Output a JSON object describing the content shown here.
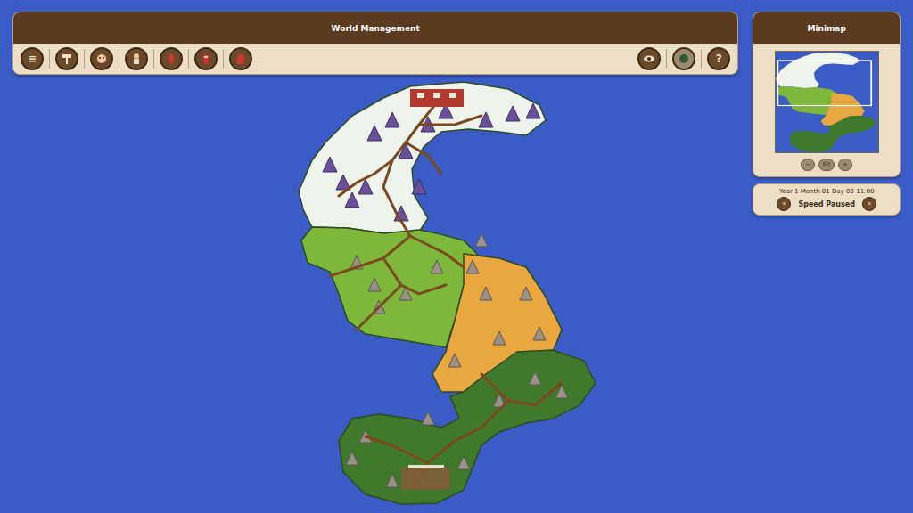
{
  "toolbar": {
    "title": "World Management",
    "menu_glyph": "≡",
    "help_glyph": "?"
  },
  "minimap": {
    "title": "Minimap",
    "zoom_buttons": [
      "−",
      "Fit",
      "+"
    ]
  },
  "time": {
    "date": "Year 1 Month 01 Day 03 11:00",
    "speed": "Speed Paused",
    "slower": "«",
    "faster": "»"
  },
  "map": {
    "regions": [
      {
        "kind": "snow",
        "color": "#eef3ec"
      },
      {
        "kind": "grassland",
        "color": "#7db83a"
      },
      {
        "kind": "desert",
        "color": "#e9a740"
      },
      {
        "kind": "forest",
        "color": "#3f7a2c"
      }
    ]
  }
}
